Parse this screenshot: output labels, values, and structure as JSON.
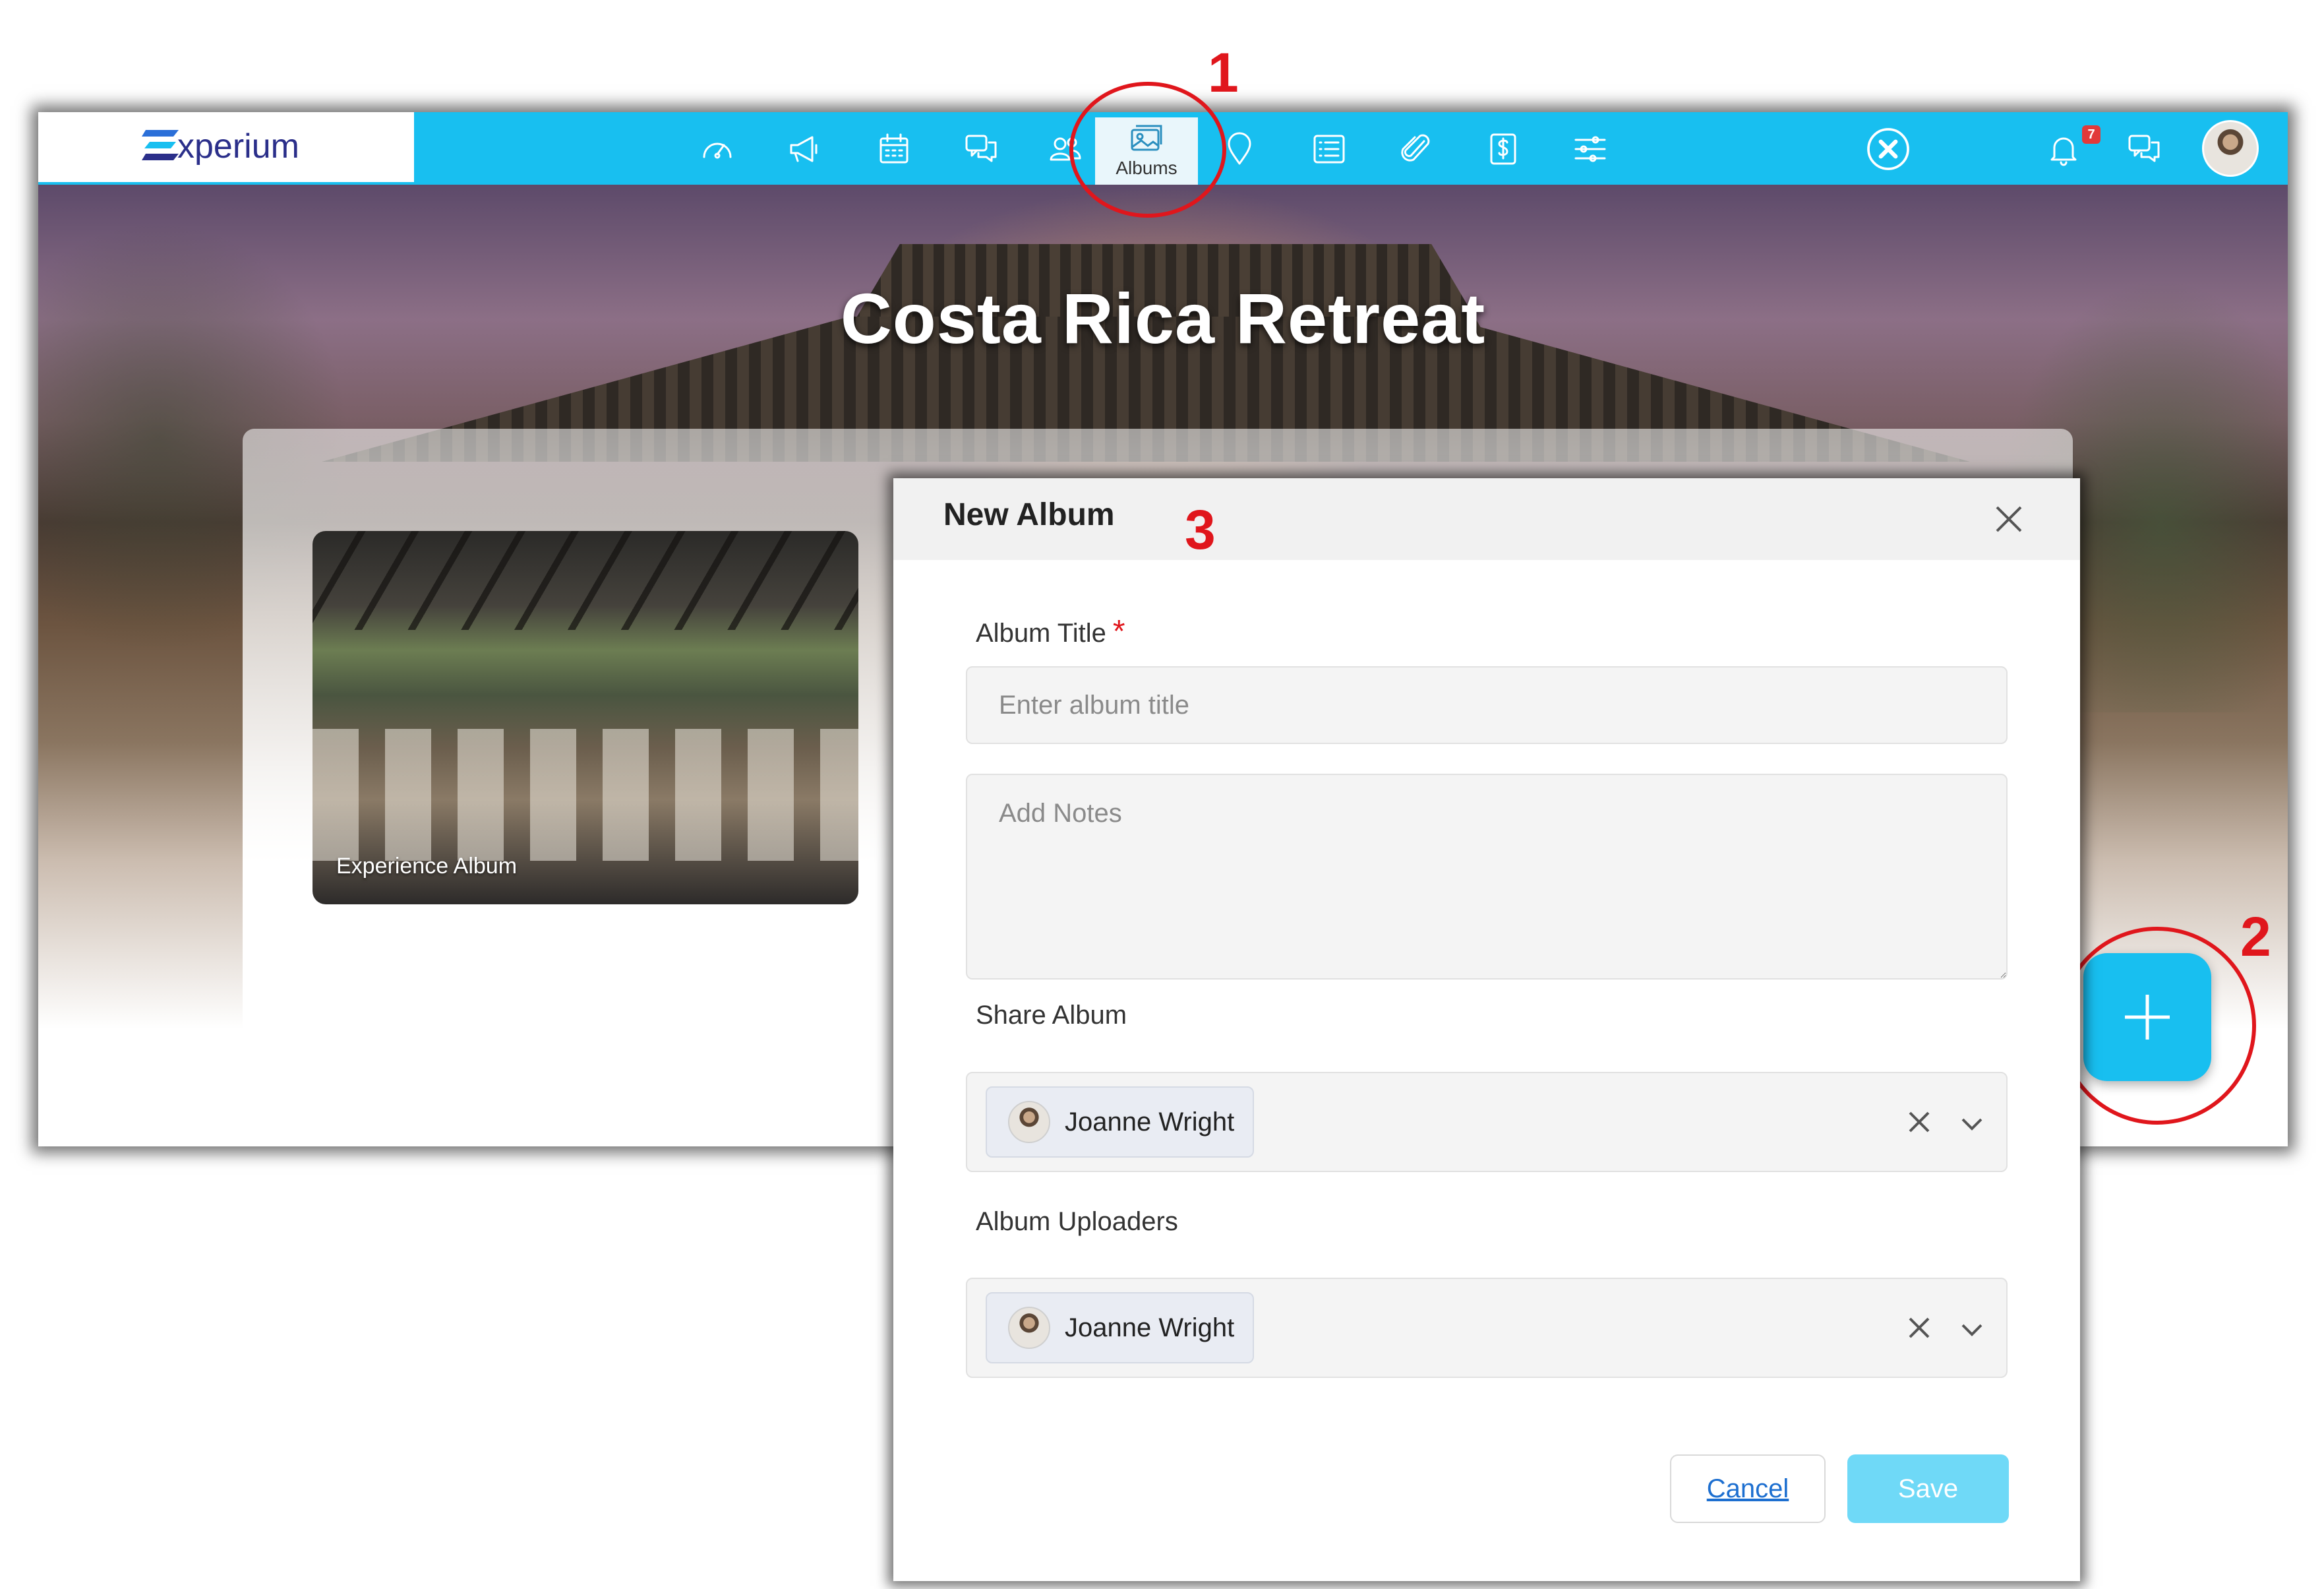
{
  "app": {
    "logo_text": "xperium",
    "nav": {
      "active_tab_label": "Albums",
      "notification_count": "7"
    },
    "hero_title": "Costa Rica Retreat"
  },
  "albums": [
    {
      "label": "Experience Album"
    }
  ],
  "annotations": {
    "one": "1",
    "two": "2",
    "three": "3"
  },
  "modal": {
    "title": "New Album",
    "album_title_label": "Album Title",
    "required_mark": "*",
    "album_title_placeholder": "Enter album title",
    "notes_placeholder": "Add Notes",
    "share_label": "Share Album",
    "share_selected": "Joanne Wright",
    "uploaders_label": "Album Uploaders",
    "uploaders_selected": "Joanne Wright",
    "cancel_label": "Cancel",
    "save_label": "Save"
  },
  "colors": {
    "brand": "#18bff0",
    "annotation": "#e0161c",
    "save_disabled": "#6fd9f7"
  }
}
